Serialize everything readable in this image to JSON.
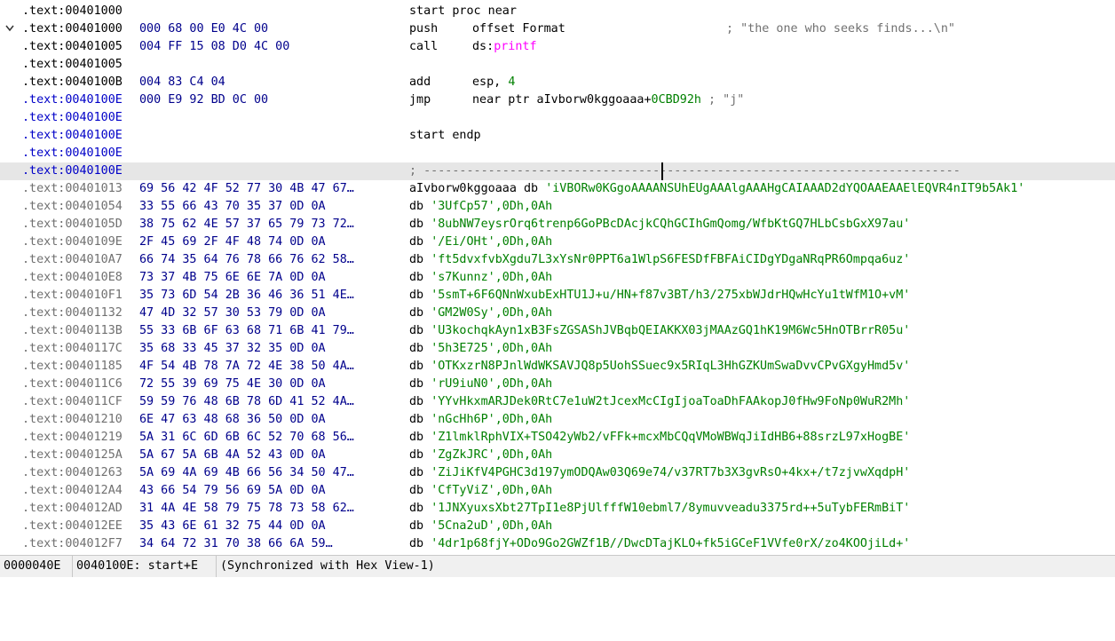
{
  "listing": {
    "rows": [
      {
        "addr": ".text:00401000",
        "addr_color": "#000000",
        "bytes": "",
        "ins": "start proc near",
        "ops": "",
        "comment": "",
        "expand": false
      },
      {
        "addr": ".text:00401000",
        "addr_color": "#000000",
        "bytes": "000 68 00 E0 4C 00",
        "ins": "push",
        "ops": "offset Format",
        "comment": "; \"the one who seeks finds...\\n\"",
        "expand": true
      },
      {
        "addr": ".text:00401005",
        "addr_color": "#000000",
        "bytes": "004 FF 15 08 D0 4C 00",
        "ins": "call",
        "ops_parts": [
          {
            "t": "ds:",
            "c": "#000000"
          },
          {
            "t": "printf",
            "c": "#ff00ff"
          }
        ],
        "comment": ""
      },
      {
        "addr": ".text:00401005",
        "addr_color": "#000000",
        "bytes": "",
        "ins": "",
        "ops": "",
        "comment": ""
      },
      {
        "addr": ".text:0040100B",
        "addr_color": "#000000",
        "bytes": "004 83 C4 04",
        "ins": "add",
        "ops_parts": [
          {
            "t": "esp, ",
            "c": "#000000"
          },
          {
            "t": "4",
            "c": "#008000"
          }
        ],
        "comment": ""
      },
      {
        "addr": ".text:0040100E",
        "addr_color": "#0000c8",
        "bytes": "000 E9 92 BD 0C 00",
        "ins": "jmp",
        "ops_parts": [
          {
            "t": "near ptr aIvborw0kggoaaa+",
            "c": "#000000"
          },
          {
            "t": "0CBD92h",
            "c": "#008000"
          },
          {
            "t": " ; \"j\"",
            "c": "#707070"
          }
        ],
        "comment": ""
      },
      {
        "addr": ".text:0040100E",
        "addr_color": "#0000c8",
        "bytes": "",
        "ins": "",
        "ops": "",
        "comment": ""
      },
      {
        "addr": ".text:0040100E",
        "addr_color": "#0000c8",
        "bytes": "",
        "ins": "start endp",
        "ops": "",
        "comment": ""
      },
      {
        "addr": ".text:0040100E",
        "addr_color": "#0000c8",
        "bytes": "",
        "ins": "",
        "ops": "",
        "comment": ""
      },
      {
        "addr": ".text:0040100E",
        "addr_color": "#0000c8",
        "bytes": "",
        "ins": "",
        "ops": "",
        "separator": "; ---------------------------------------------------------------------------",
        "highlight": true
      }
    ],
    "data_rows": [
      {
        "addr": ".text:00401013",
        "bytes": "69 56 42 4F 52 77 30 4B 47 67…",
        "label": "aIvborw0kggoaaa db ",
        "str": "'iVBORw0KGgoAAAANSUhEUgAAAlgAAAHgCAIAAAD2dYQOAAEAAElEQVR4nIT9b5Ak1'",
        "tail": ""
      },
      {
        "addr": ".text:00401054",
        "bytes": "33 55 66 43 70 35 37 0D 0A",
        "label": "db ",
        "str": "'3UfCp57'",
        "tail": ",0Dh,0Ah"
      },
      {
        "addr": ".text:0040105D",
        "bytes": "38 75 62 4E 57 37 65 79 73 72…",
        "label": "db ",
        "str": "'8ubNW7eysrOrq6trenp6GoPBcDAcjkCQhGCIhGmQomg/WfbKtGQ7HLbCsbGxX97au'",
        "tail": ""
      },
      {
        "addr": ".text:0040109E",
        "bytes": "2F 45 69 2F 4F 48 74 0D 0A",
        "label": "db ",
        "str": "'/Ei/OHt'",
        "tail": ",0Dh,0Ah"
      },
      {
        "addr": ".text:004010A7",
        "bytes": "66 74 35 64 76 78 66 76 62 58…",
        "label": "db ",
        "str": "'ft5dvxfvbXgdu7L3xYsNr0PPT6a1WlpS6FESDfFBFAiCIDgYDgaNRqPR6Ompqa6uz'",
        "tail": ""
      },
      {
        "addr": ".text:004010E8",
        "bytes": "73 37 4B 75 6E 6E 7A 0D 0A",
        "label": "db ",
        "str": "'s7Kunnz'",
        "tail": ",0Dh,0Ah"
      },
      {
        "addr": ".text:004010F1",
        "bytes": "35 73 6D 54 2B 36 46 36 51 4E…",
        "label": "db ",
        "str": "'5smT+6F6QNnWxubExHTU1J+u/HN+f87v3BT/h3/275xbWJdrHQwHcYu1tWfM1O+vM'",
        "tail": ""
      },
      {
        "addr": ".text:00401132",
        "bytes": "47 4D 32 57 30 53 79 0D 0A",
        "label": "db ",
        "str": "'GM2W0Sy'",
        "tail": ",0Dh,0Ah"
      },
      {
        "addr": ".text:0040113B",
        "bytes": "55 33 6B 6F 63 68 71 6B 41 79…",
        "label": "db ",
        "str": "'U3kochqkAyn1xB3FsZGSAShJVBqbQEIAKKX03jMAAzGQ1hK19M6Wc5HnOTBrrR05u'",
        "tail": ""
      },
      {
        "addr": ".text:0040117C",
        "bytes": "35 68 33 45 37 32 35 0D 0A",
        "label": "db ",
        "str": "'5h3E725'",
        "tail": ",0Dh,0Ah"
      },
      {
        "addr": ".text:00401185",
        "bytes": "4F 54 4B 78 7A 72 4E 38 50 4A…",
        "label": "db ",
        "str": "'OTKxzrN8PJnlWdWKSAVJQ8p5UohSSuec9x5RIqL3HhGZKUmSwaDvvCPvGXgyHmd5v'",
        "tail": ""
      },
      {
        "addr": ".text:004011C6",
        "bytes": "72 55 39 69 75 4E 30 0D 0A",
        "label": "db ",
        "str": "'rU9iuN0'",
        "tail": ",0Dh,0Ah"
      },
      {
        "addr": ".text:004011CF",
        "bytes": "59 59 76 48 6B 78 6D 41 52 4A…",
        "label": "db ",
        "str": "'YYvHkxmARJDek0RtC7e1uW2tJcexMcCIgIjoaToaDhFAAkopJ0fHw9FoNp0WuR2Mh'",
        "tail": ""
      },
      {
        "addr": ".text:00401210",
        "bytes": "6E 47 63 48 68 36 50 0D 0A",
        "label": "db ",
        "str": "'nGcHh6P'",
        "tail": ",0Dh,0Ah"
      },
      {
        "addr": ".text:00401219",
        "bytes": "5A 31 6C 6D 6B 6C 52 70 68 56…",
        "label": "db ",
        "str": "'Z1lmklRphVIX+TSO42yWb2/vFFk+mcxMbCQqVMoWBWqJiIdHB6+88srzL97xHogBE'",
        "tail": ""
      },
      {
        "addr": ".text:0040125A",
        "bytes": "5A 67 5A 6B 4A 52 43 0D 0A",
        "label": "db ",
        "str": "'ZgZkJRC'",
        "tail": ",0Dh,0Ah"
      },
      {
        "addr": ".text:00401263",
        "bytes": "5A 69 4A 69 4B 66 56 34 50 47…",
        "label": "db ",
        "str": "'ZiJiKfV4PGHC3d197ymODQAw03Q69e74/v37RT7b3X3gvRsO+4kx+/t7zjvwXqdpH'",
        "tail": ""
      },
      {
        "addr": ".text:004012A4",
        "bytes": "43 66 54 79 56 69 5A 0D 0A",
        "label": "db ",
        "str": "'CfTyViZ'",
        "tail": ",0Dh,0Ah"
      },
      {
        "addr": ".text:004012AD",
        "bytes": "31 4A 4E 58 79 75 78 73 58 62…",
        "label": "db ",
        "str": "'1JNXyuxsXbt27TpI1e8PjUlfffW10ebml7/8ymuvveadu3375rd++5uTybFERmBiT'",
        "tail": ""
      },
      {
        "addr": ".text:004012EE",
        "bytes": "35 43 6E 61 32 75 44 0D 0A",
        "label": "db ",
        "str": "'5Cna2uD'",
        "tail": ",0Dh,0Ah"
      },
      {
        "addr": ".text:004012F7",
        "bytes": "34 64 72 31 70 38 66 6A 59…",
        "label": "db ",
        "str": "'4dr1p68fjY+ODo9Go2GWZf1B//DwcDTajKLO+fk5iGCeF1VVfe0rX/zo4KOOjiLd+'",
        "tail": ""
      }
    ]
  },
  "statusbar": {
    "offset": "0000040E",
    "location": "0040100E: start+E",
    "sync": "(Synchronized with Hex View-1)"
  },
  "colors": {
    "string": "#008000",
    "bytes": "#00008c",
    "import": "#ff00ff",
    "comment": "#707070",
    "highlight_row": "#e6e6e6"
  }
}
